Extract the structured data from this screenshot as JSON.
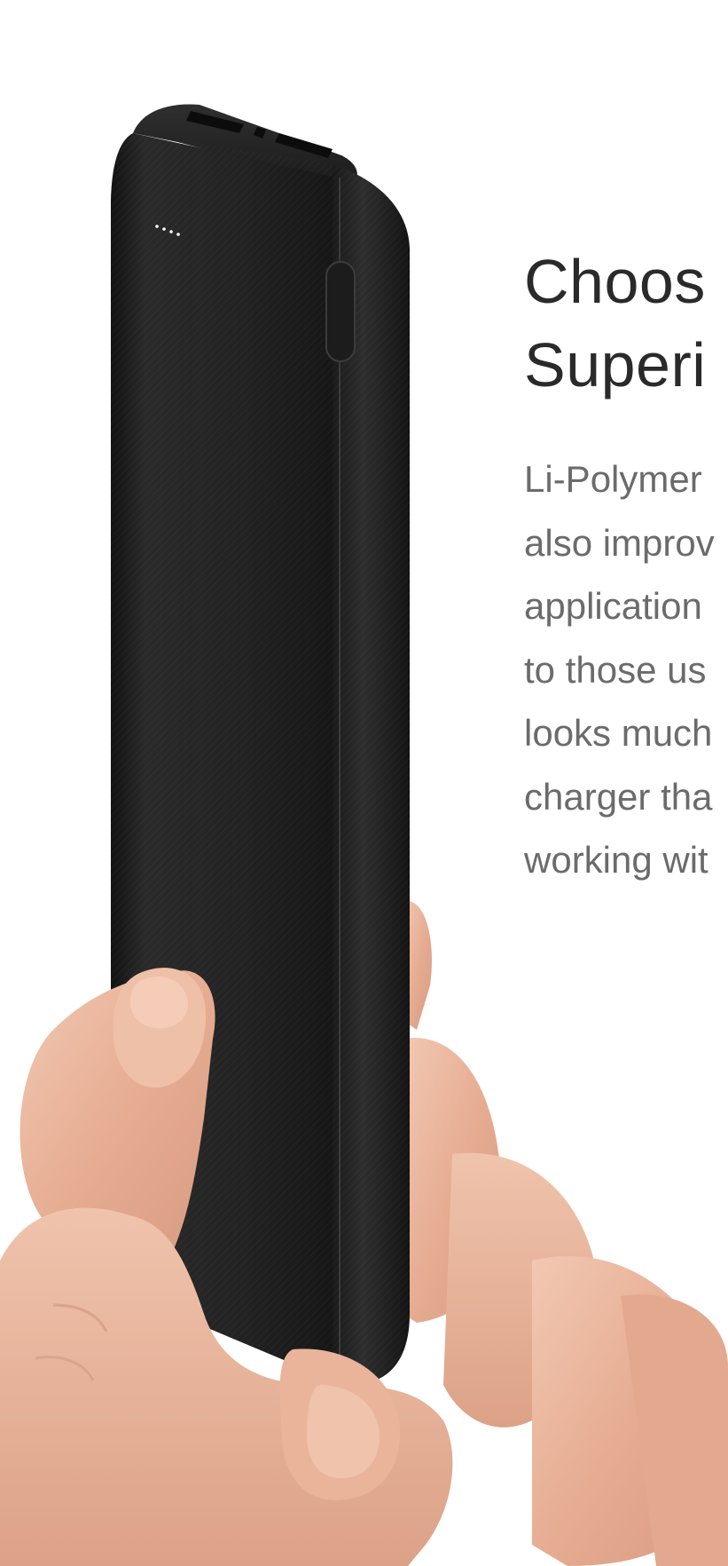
{
  "hero": {
    "image_label": "power-bank-in-hand",
    "colors": {
      "device": "#1e1e1e",
      "skin": "#e8b8a0",
      "background": "#ffffff"
    }
  },
  "text": {
    "headline": [
      "Choos",
      "Superi"
    ],
    "body_lines": [
      "Li-Polymer",
      "also improv",
      "application",
      "to those us",
      "looks much",
      "charger tha",
      "working wit"
    ]
  }
}
